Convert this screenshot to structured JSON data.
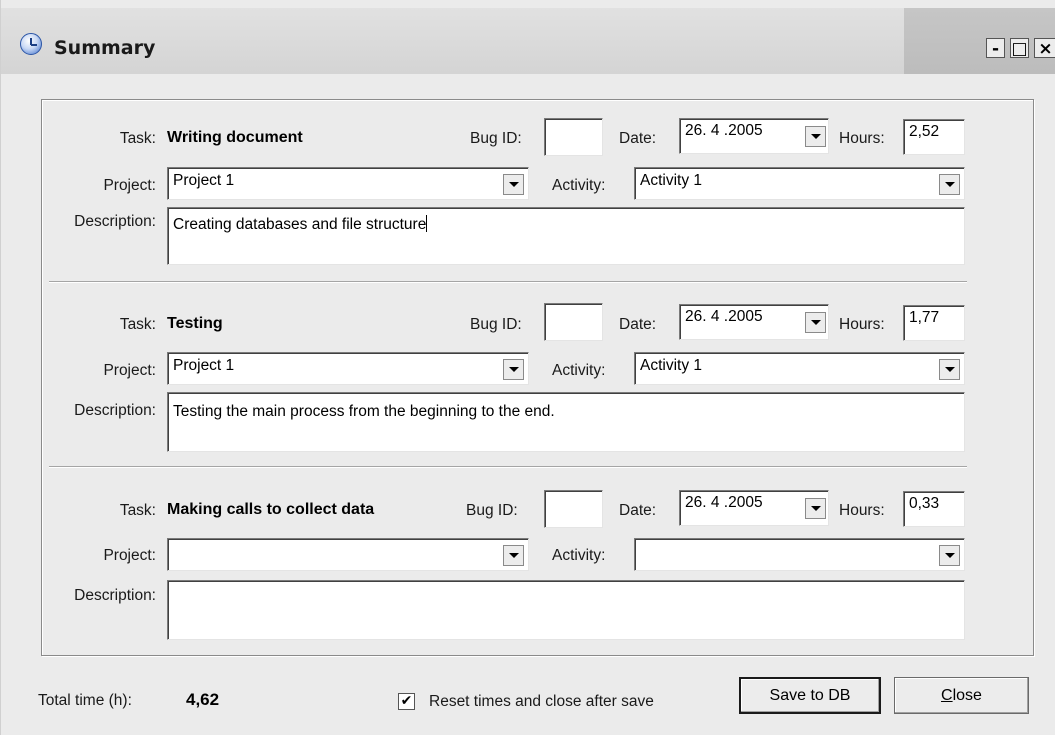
{
  "window": {
    "title": "Summary",
    "minimize_label": "-",
    "maximize_label": "□",
    "close_label": "×"
  },
  "labels": {
    "task": "Task:",
    "bug_id": "Bug ID:",
    "date": "Date:",
    "hours": "Hours:",
    "project": "Project:",
    "activity": "Activity:",
    "description": "Description:"
  },
  "tasks": [
    {
      "name": "Writing document",
      "bug_id": "",
      "date": "26. 4 .2005",
      "hours": "2,52",
      "project": "Project 1",
      "activity": "Activity 1",
      "description": "Creating databases and file structure"
    },
    {
      "name": "Testing",
      "bug_id": "",
      "date": "26. 4 .2005",
      "hours": "1,77",
      "project": "Project 1",
      "activity": "Activity 1",
      "description": "Testing the main process from the beginning to the end."
    },
    {
      "name": "Making calls to collect data",
      "bug_id": "",
      "date": "26. 4 .2005",
      "hours": "0,33",
      "project": "",
      "activity": "",
      "description": ""
    }
  ],
  "footer": {
    "total_label": "Total time (h):",
    "total_value": "4,62",
    "checkbox_label": "Reset times and close after save",
    "checkbox_checked": true,
    "checkbox_mark": "✔",
    "save_button": "Save to DB",
    "close_button": "Close"
  },
  "icons": [
    "clock-icon",
    "dropdown-arrow-icon",
    "checkmark-icon"
  ]
}
